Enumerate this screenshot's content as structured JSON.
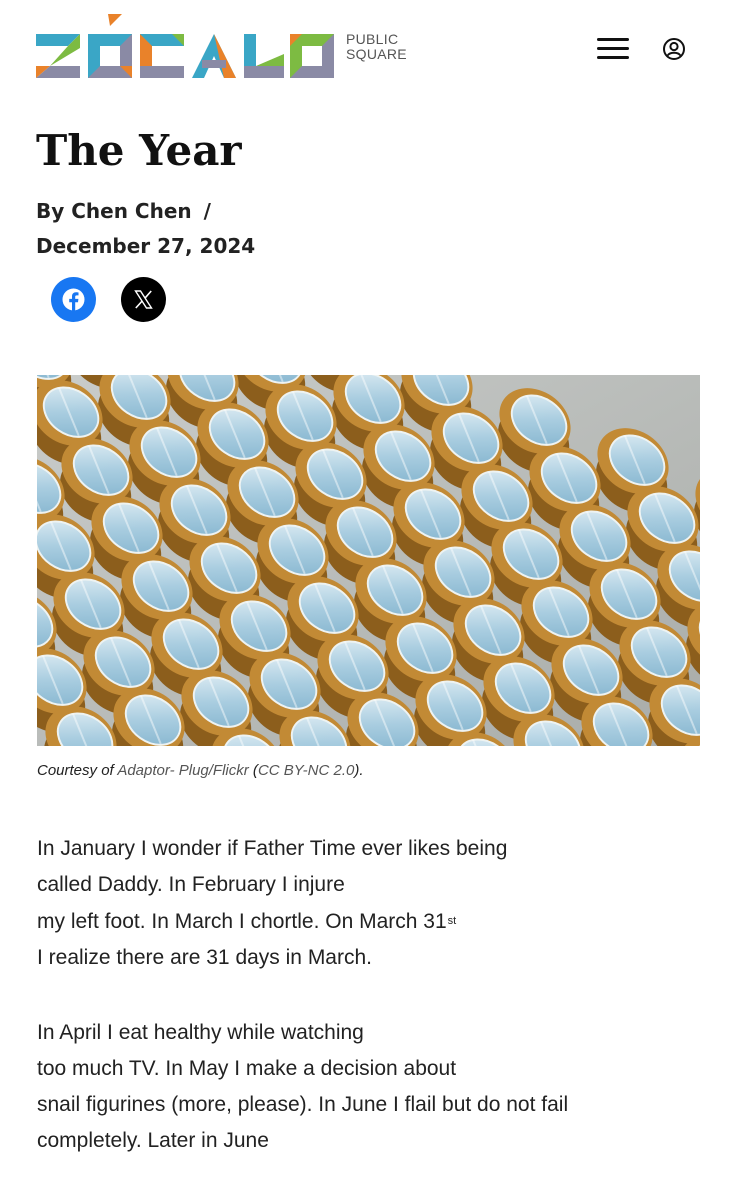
{
  "brand": {
    "name": "ZÓCALO",
    "sub_line1": "PUBLIC",
    "sub_line2": "SQUARE"
  },
  "header": {
    "menu_icon": "hamburger-menu-icon",
    "account_icon": "user-account-icon"
  },
  "article": {
    "title": "The Year",
    "byline": "By Chen Chen",
    "byline_separator": "/",
    "date": "December 27, 2024"
  },
  "share": {
    "facebook_icon": "facebook-icon",
    "x_icon": "x-icon"
  },
  "image": {
    "caption_prefix": "Courtesy of ",
    "caption_link": "Adaptor- Plug/Flickr",
    "caption_license_open": " (",
    "caption_license": "CC BY-NC 2.0",
    "caption_license_close": ")."
  },
  "poem": {
    "stanza1": [
      "In January I wonder if Father Time ever likes being",
      "called Daddy. In February I injure",
      "my left foot. In March I chortle. On March 31",
      "I realize there are 31 days in March."
    ],
    "stanza1_sup": "st",
    "stanza2": [
      "In April I eat healthy while watching",
      "too much TV. In May I make a decision about",
      "snail figurines (more, please). In June I flail but do not fail",
      "completely. Later in June"
    ]
  },
  "colors": {
    "facebook": "#1877f2",
    "x": "#000000",
    "text": "#222222"
  }
}
